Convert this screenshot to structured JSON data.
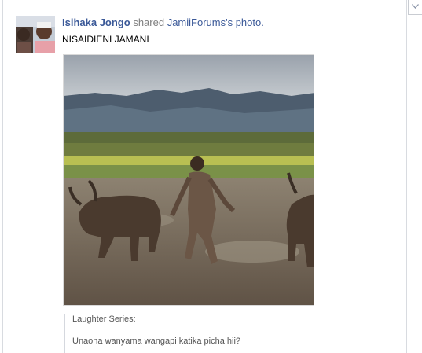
{
  "post": {
    "author": "Isihaka Jongo",
    "verb": "shared",
    "page_name": "JamiiForums's photo.",
    "message": "NISAIDIENI JAMANI"
  },
  "quote": {
    "line1": "Laughter Series:",
    "line2": "Unaona wanyama wangapi katika picha hii?"
  },
  "icons": {
    "menu": "chevron-down-icon"
  }
}
